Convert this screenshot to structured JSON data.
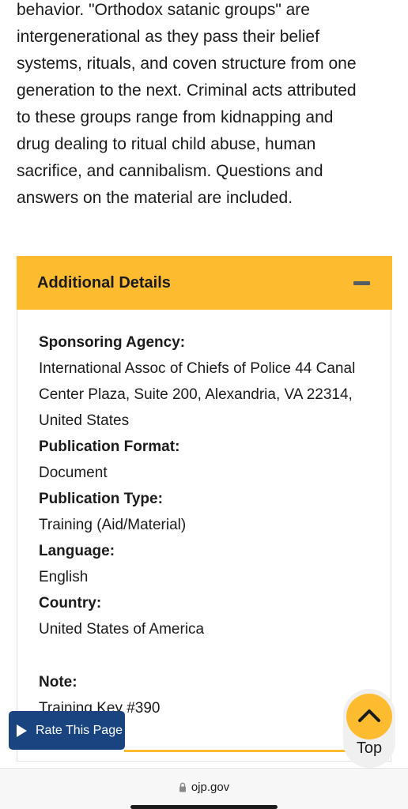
{
  "abstract": {
    "lines": [
      "behavior. \"Orthodox satanic groups\" are",
      "intergenerational as they pass their belief",
      "systems, rituals, and coven structure from one",
      "generation to the next. Criminal acts attributed",
      "to these groups range from kidnapping and",
      "drug dealing to ritual child abuse, human",
      "sacrifice, and cannibalism. Questions and",
      "answers on the material are included."
    ]
  },
  "additional_details": {
    "title": "Additional Details",
    "toggle_icon": "minus-icon",
    "fields": [
      {
        "label": "Sponsoring Agency:",
        "value": "International Assoc of Chiefs of Police 44 Canal Center Plaza, Suite 200, Alexandria, VA 22314, United States"
      },
      {
        "label": "Publication Format:",
        "value": "Document"
      },
      {
        "label": "Publication Type:",
        "value": "Training (Aid/Material)"
      },
      {
        "label": "Language:",
        "value": "English"
      },
      {
        "label": "Country:",
        "value": "United States of America"
      }
    ],
    "note": {
      "label": "Note:",
      "value": "Training Key #390"
    }
  },
  "rate_button": {
    "label": "Rate This Page",
    "icon": "play-icon"
  },
  "top_button": {
    "label": "Top",
    "icon": "chevron-up-icon"
  },
  "browser": {
    "url": "ojp.gov",
    "icon": "lock-icon"
  },
  "colors": {
    "accent": "#fdbb30",
    "rate_button": "#1a4480",
    "text": "#1b1b1b"
  }
}
